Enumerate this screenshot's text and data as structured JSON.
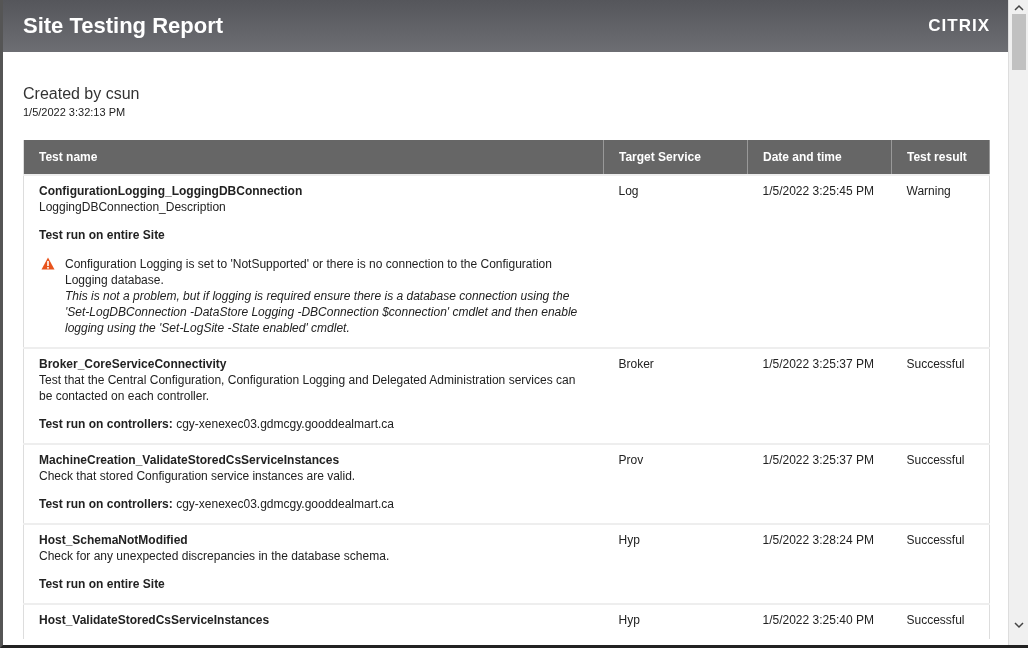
{
  "header": {
    "title": "Site Testing Report",
    "logo": "CITRIX"
  },
  "created_by": "Created by csun",
  "created_at": "1/5/2022 3:32:13 PM",
  "table": {
    "columns": [
      "Test name",
      "Target Service",
      "Date and time",
      "Test result"
    ],
    "rows": [
      {
        "name": "ConfigurationLogging_LoggingDBConnection",
        "description": "LoggingDBConnection_Description",
        "scope_label": "Test run on entire Site",
        "service": "Log",
        "datetime": "1/5/2022 3:25:45 PM",
        "result": "Warning",
        "warning": {
          "message": "Configuration Logging is set to 'NotSupported' or there is no connection to the Configuration Logging database.",
          "detail": "This is not a problem, but if logging is required ensure there is a database connection using the 'Set-LogDBConnection -DataStore Logging -DBConnection $connection' cmdlet and then enable logging using the 'Set-LogSite -State enabled' cmdlet."
        }
      },
      {
        "name": "Broker_CoreServiceConnectivity",
        "description": "Test that the Central Configuration, Configuration Logging and Delegated Administration services can be contacted on each controller.",
        "scope_label": "Test run on controllers:",
        "scope_value": "cgy-xenexec03.gdmcgy.gooddealmart.ca",
        "service": "Broker",
        "datetime": "1/5/2022 3:25:37 PM",
        "result": "Successful"
      },
      {
        "name": "MachineCreation_ValidateStoredCsServiceInstances",
        "description": "Check that stored Configuration service instances are valid.",
        "scope_label": "Test run on controllers:",
        "scope_value": "cgy-xenexec03.gdmcgy.gooddealmart.ca",
        "service": "Prov",
        "datetime": "1/5/2022 3:25:37 PM",
        "result": "Successful"
      },
      {
        "name": "Host_SchemaNotModified",
        "description": "Check for any unexpected discrepancies in the database schema.",
        "scope_label": "Test run on entire Site",
        "service": "Hyp",
        "datetime": "1/5/2022 3:28:24 PM",
        "result": "Successful"
      },
      {
        "name": "Host_ValidateStoredCsServiceInstances",
        "service": "Hyp",
        "datetime": "1/5/2022 3:25:40 PM",
        "result": "Successful"
      }
    ]
  }
}
